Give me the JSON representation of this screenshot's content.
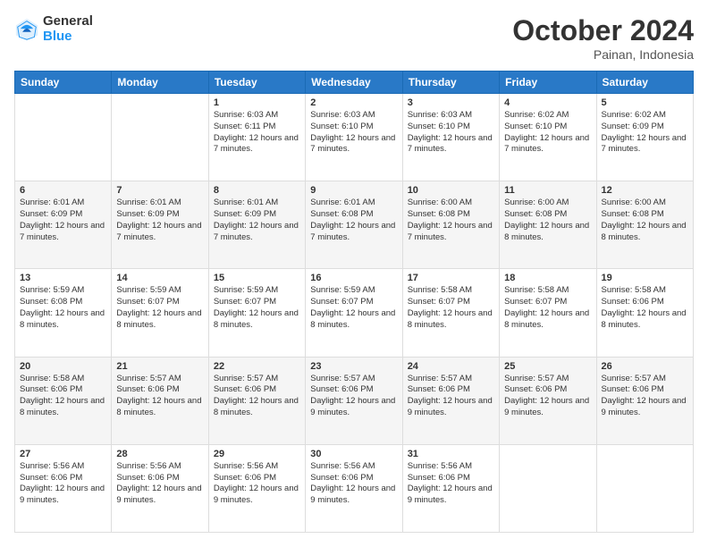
{
  "logo": {
    "general": "General",
    "blue": "Blue"
  },
  "header": {
    "month": "October 2024",
    "location": "Painan, Indonesia"
  },
  "weekdays": [
    "Sunday",
    "Monday",
    "Tuesday",
    "Wednesday",
    "Thursday",
    "Friday",
    "Saturday"
  ],
  "weeks": [
    [
      {
        "day": "",
        "info": ""
      },
      {
        "day": "",
        "info": ""
      },
      {
        "day": "1",
        "info": "Sunrise: 6:03 AM\nSunset: 6:11 PM\nDaylight: 12 hours and 7 minutes."
      },
      {
        "day": "2",
        "info": "Sunrise: 6:03 AM\nSunset: 6:10 PM\nDaylight: 12 hours and 7 minutes."
      },
      {
        "day": "3",
        "info": "Sunrise: 6:03 AM\nSunset: 6:10 PM\nDaylight: 12 hours and 7 minutes."
      },
      {
        "day": "4",
        "info": "Sunrise: 6:02 AM\nSunset: 6:10 PM\nDaylight: 12 hours and 7 minutes."
      },
      {
        "day": "5",
        "info": "Sunrise: 6:02 AM\nSunset: 6:09 PM\nDaylight: 12 hours and 7 minutes."
      }
    ],
    [
      {
        "day": "6",
        "info": "Sunrise: 6:01 AM\nSunset: 6:09 PM\nDaylight: 12 hours and 7 minutes."
      },
      {
        "day": "7",
        "info": "Sunrise: 6:01 AM\nSunset: 6:09 PM\nDaylight: 12 hours and 7 minutes."
      },
      {
        "day": "8",
        "info": "Sunrise: 6:01 AM\nSunset: 6:09 PM\nDaylight: 12 hours and 7 minutes."
      },
      {
        "day": "9",
        "info": "Sunrise: 6:01 AM\nSunset: 6:08 PM\nDaylight: 12 hours and 7 minutes."
      },
      {
        "day": "10",
        "info": "Sunrise: 6:00 AM\nSunset: 6:08 PM\nDaylight: 12 hours and 7 minutes."
      },
      {
        "day": "11",
        "info": "Sunrise: 6:00 AM\nSunset: 6:08 PM\nDaylight: 12 hours and 8 minutes."
      },
      {
        "day": "12",
        "info": "Sunrise: 6:00 AM\nSunset: 6:08 PM\nDaylight: 12 hours and 8 minutes."
      }
    ],
    [
      {
        "day": "13",
        "info": "Sunrise: 5:59 AM\nSunset: 6:08 PM\nDaylight: 12 hours and 8 minutes."
      },
      {
        "day": "14",
        "info": "Sunrise: 5:59 AM\nSunset: 6:07 PM\nDaylight: 12 hours and 8 minutes."
      },
      {
        "day": "15",
        "info": "Sunrise: 5:59 AM\nSunset: 6:07 PM\nDaylight: 12 hours and 8 minutes."
      },
      {
        "day": "16",
        "info": "Sunrise: 5:59 AM\nSunset: 6:07 PM\nDaylight: 12 hours and 8 minutes."
      },
      {
        "day": "17",
        "info": "Sunrise: 5:58 AM\nSunset: 6:07 PM\nDaylight: 12 hours and 8 minutes."
      },
      {
        "day": "18",
        "info": "Sunrise: 5:58 AM\nSunset: 6:07 PM\nDaylight: 12 hours and 8 minutes."
      },
      {
        "day": "19",
        "info": "Sunrise: 5:58 AM\nSunset: 6:06 PM\nDaylight: 12 hours and 8 minutes."
      }
    ],
    [
      {
        "day": "20",
        "info": "Sunrise: 5:58 AM\nSunset: 6:06 PM\nDaylight: 12 hours and 8 minutes."
      },
      {
        "day": "21",
        "info": "Sunrise: 5:57 AM\nSunset: 6:06 PM\nDaylight: 12 hours and 8 minutes."
      },
      {
        "day": "22",
        "info": "Sunrise: 5:57 AM\nSunset: 6:06 PM\nDaylight: 12 hours and 8 minutes."
      },
      {
        "day": "23",
        "info": "Sunrise: 5:57 AM\nSunset: 6:06 PM\nDaylight: 12 hours and 9 minutes."
      },
      {
        "day": "24",
        "info": "Sunrise: 5:57 AM\nSunset: 6:06 PM\nDaylight: 12 hours and 9 minutes."
      },
      {
        "day": "25",
        "info": "Sunrise: 5:57 AM\nSunset: 6:06 PM\nDaylight: 12 hours and 9 minutes."
      },
      {
        "day": "26",
        "info": "Sunrise: 5:57 AM\nSunset: 6:06 PM\nDaylight: 12 hours and 9 minutes."
      }
    ],
    [
      {
        "day": "27",
        "info": "Sunrise: 5:56 AM\nSunset: 6:06 PM\nDaylight: 12 hours and 9 minutes."
      },
      {
        "day": "28",
        "info": "Sunrise: 5:56 AM\nSunset: 6:06 PM\nDaylight: 12 hours and 9 minutes."
      },
      {
        "day": "29",
        "info": "Sunrise: 5:56 AM\nSunset: 6:06 PM\nDaylight: 12 hours and 9 minutes."
      },
      {
        "day": "30",
        "info": "Sunrise: 5:56 AM\nSunset: 6:06 PM\nDaylight: 12 hours and 9 minutes."
      },
      {
        "day": "31",
        "info": "Sunrise: 5:56 AM\nSunset: 6:06 PM\nDaylight: 12 hours and 9 minutes."
      },
      {
        "day": "",
        "info": ""
      },
      {
        "day": "",
        "info": ""
      }
    ]
  ]
}
